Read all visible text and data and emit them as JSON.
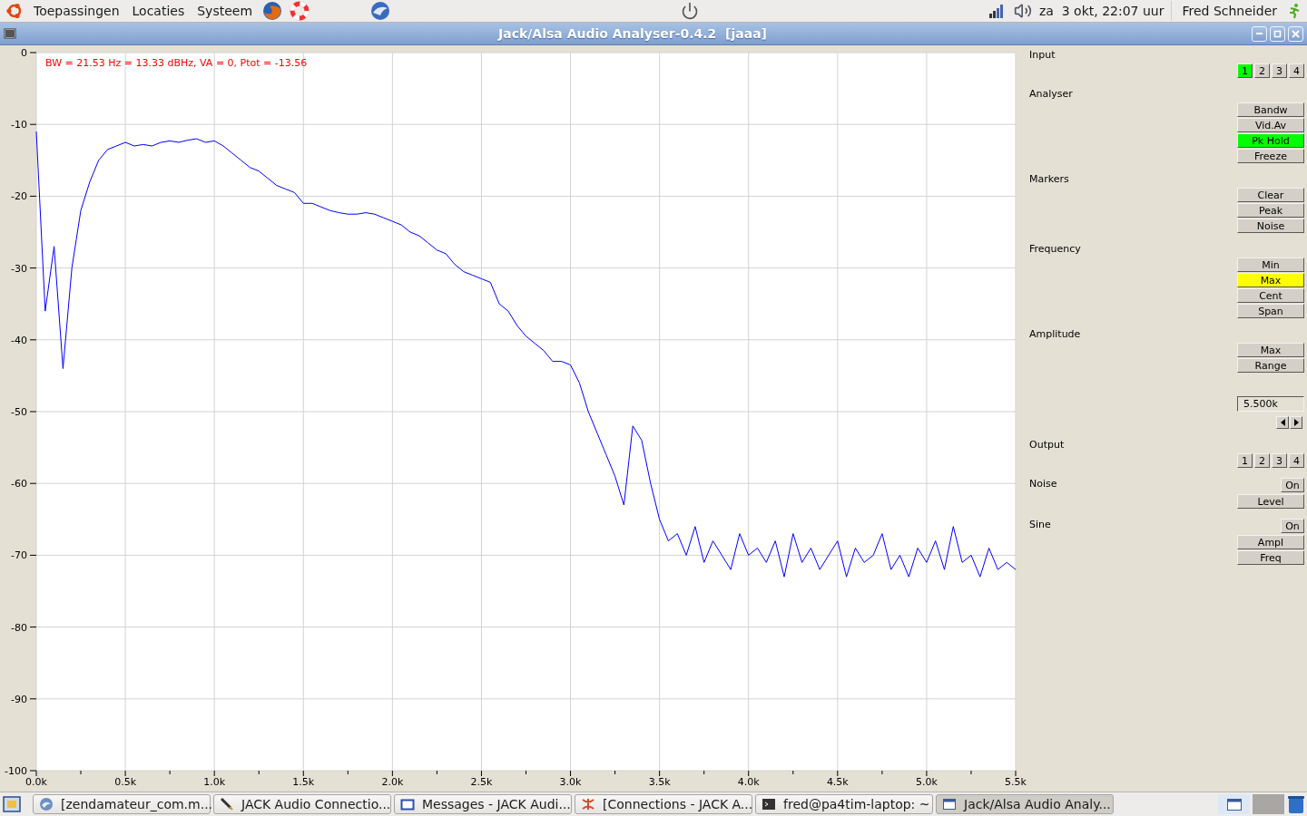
{
  "top_panel": {
    "menus": [
      "Toepassingen",
      "Locaties",
      "Systeem"
    ],
    "clock": "za  3 okt, 22:07 uur",
    "user": "Fred Schneider"
  },
  "window": {
    "title": "Jack/Alsa Audio Analyser-0.4.2  [jaaa]"
  },
  "spectrum": {
    "readout": "BW = 21.53 Hz = 13.33 dBHz, VA = 0, Ptot = -13.56",
    "chart_data": {
      "type": "line",
      "grid": true,
      "xlim": [
        0,
        5.5
      ],
      "ylim": [
        -100,
        0
      ],
      "xticks": [
        {
          "value": 0,
          "label": "0.0k"
        },
        {
          "value": 0.5,
          "label": "0.5k"
        },
        {
          "value": 1,
          "label": "1.0k"
        },
        {
          "value": 1.5,
          "label": "1.5k"
        },
        {
          "value": 2,
          "label": "2.0k"
        },
        {
          "value": 2.5,
          "label": "2.5k"
        },
        {
          "value": 3,
          "label": "3.0k"
        },
        {
          "value": 3.5,
          "label": "3.5k"
        },
        {
          "value": 4,
          "label": "4.0k"
        },
        {
          "value": 4.5,
          "label": "4.5k"
        },
        {
          "value": 5,
          "label": "5.0k"
        },
        {
          "value": 5.5,
          "label": "5.5k"
        }
      ],
      "yticks": [
        0,
        -10,
        -20,
        -30,
        -40,
        -50,
        -60,
        -70,
        -80,
        -90,
        -100
      ],
      "x": [
        0,
        0.05,
        0.1,
        0.15,
        0.2,
        0.25,
        0.3,
        0.35,
        0.4,
        0.45,
        0.5,
        0.55,
        0.6,
        0.65,
        0.7,
        0.75,
        0.8,
        0.85,
        0.9,
        0.95,
        1,
        1.05,
        1.1,
        1.15,
        1.2,
        1.25,
        1.3,
        1.35,
        1.4,
        1.45,
        1.5,
        1.55,
        1.6,
        1.65,
        1.7,
        1.75,
        1.8,
        1.85,
        1.9,
        1.95,
        2,
        2.05,
        2.1,
        2.15,
        2.2,
        2.25,
        2.3,
        2.35,
        2.4,
        2.45,
        2.5,
        2.55,
        2.6,
        2.65,
        2.7,
        2.75,
        2.8,
        2.85,
        2.9,
        2.95,
        3,
        3.05,
        3.1,
        3.15,
        3.2,
        3.25,
        3.3,
        3.35,
        3.4,
        3.45,
        3.5,
        3.55,
        3.6,
        3.65,
        3.7,
        3.75,
        3.8,
        3.85,
        3.9,
        3.95,
        4,
        4.05,
        4.1,
        4.15,
        4.2,
        4.25,
        4.3,
        4.35,
        4.4,
        4.45,
        4.5,
        4.55,
        4.6,
        4.65,
        4.7,
        4.75,
        4.8,
        4.85,
        4.9,
        4.95,
        5,
        5.05,
        5.1,
        5.15,
        5.2,
        5.25,
        5.3,
        5.35,
        5.4,
        5.45,
        5.5
      ],
      "series": [
        {
          "color": "#0000ff",
          "values": [
            -11,
            -36,
            -27,
            -44,
            -30,
            -22,
            -18,
            -15,
            -13.5,
            -13,
            -12.5,
            -13,
            -12.8,
            -13,
            -12.5,
            -12.3,
            -12.5,
            -12.2,
            -12,
            -12.5,
            -12.3,
            -13,
            -14,
            -15,
            -16,
            -16.5,
            -17.5,
            -18.5,
            -19,
            -19.5,
            -21,
            -21,
            -21.5,
            -22,
            -22.3,
            -22.5,
            -22.5,
            -22.3,
            -22.5,
            -23,
            -23.5,
            -24,
            -25,
            -25.5,
            -26.5,
            -27.5,
            -28,
            -29.5,
            -30.5,
            -31,
            -31.5,
            -32,
            -35,
            -36,
            -38,
            -39.5,
            -40.5,
            -41.5,
            -43,
            -43,
            -43.5,
            -46,
            -50,
            -53,
            -56,
            -59,
            -63,
            -52,
            -54,
            -60,
            -65,
            -68,
            -67,
            -70,
            -66,
            -71,
            -68,
            -70,
            -72,
            -67,
            -70,
            -69,
            -71,
            -68,
            -73,
            -67,
            -71,
            -69,
            -72,
            -70,
            -68,
            -73,
            -69,
            -71,
            -70,
            -67,
            -72,
            -70,
            -73,
            -69,
            -71,
            -68,
            -72,
            -66,
            -71,
            -70,
            -73,
            -69,
            -72,
            -71,
            -72
          ]
        }
      ]
    }
  },
  "controls": [
    {
      "label": "Input",
      "rows": [
        {
          "kind": "numbers",
          "buttons": [
            {
              "label": "1",
              "selected": true,
              "color": "#00ff00"
            },
            {
              "label": "2",
              "selected": false
            },
            {
              "label": "3",
              "selected": false
            },
            {
              "label": "4",
              "selected": false
            }
          ]
        }
      ]
    },
    {
      "label": "Analyser",
      "rows": [
        {
          "kind": "stack",
          "buttons": [
            {
              "label": "Bandw",
              "selected": false
            },
            {
              "label": "Vid.Av",
              "selected": false
            },
            {
              "label": "Pk Hold",
              "selected": true,
              "color": "#00ff00"
            },
            {
              "label": "Freeze",
              "selected": false
            }
          ]
        }
      ]
    },
    {
      "label": "Markers",
      "rows": [
        {
          "kind": "stack",
          "buttons": [
            {
              "label": "Clear",
              "selected": false
            },
            {
              "label": "Peak",
              "selected": false
            },
            {
              "label": "Noise",
              "selected": false
            }
          ]
        }
      ]
    },
    {
      "label": "Frequency",
      "rows": [
        {
          "kind": "stack",
          "buttons": [
            {
              "label": "Min",
              "selected": false
            },
            {
              "label": "Max",
              "selected": true,
              "color": "#ffff00"
            },
            {
              "label": "Cent",
              "selected": false
            },
            {
              "label": "Span",
              "selected": false
            }
          ]
        }
      ]
    },
    {
      "label": "Amplitude",
      "rows": [
        {
          "kind": "stack",
          "buttons": [
            {
              "label": "Max",
              "selected": false
            },
            {
              "label": "Range",
              "selected": false
            }
          ]
        },
        {
          "kind": "field",
          "value": "5.500k"
        }
      ]
    },
    {
      "label": "Output",
      "rows": [
        {
          "kind": "numbers",
          "buttons": [
            {
              "label": "1",
              "selected": false
            },
            {
              "label": "2",
              "selected": false
            },
            {
              "label": "3",
              "selected": false
            },
            {
              "label": "4",
              "selected": false
            }
          ]
        }
      ]
    },
    {
      "label": "Noise",
      "toggle": {
        "label": "On",
        "selected": false
      },
      "rows": [
        {
          "kind": "stack",
          "buttons": [
            {
              "label": "Level",
              "selected": false
            }
          ]
        }
      ]
    },
    {
      "label": "Sine",
      "toggle": {
        "label": "On",
        "selected": false
      },
      "rows": [
        {
          "kind": "stack",
          "buttons": [
            {
              "label": "Ampl",
              "selected": false
            },
            {
              "label": "Freq",
              "selected": false
            }
          ]
        }
      ]
    }
  ],
  "taskbar": {
    "tasks": [
      {
        "label": "[zendamateur_com.m...",
        "selected": false
      },
      {
        "label": "JACK Audio Connectio...",
        "selected": false
      },
      {
        "label": "Messages - JACK Audi...",
        "selected": false
      },
      {
        "label": "[Connections - JACK A...",
        "selected": false
      },
      {
        "label": "fred@pa4tim-laptop: ~",
        "selected": false
      },
      {
        "label": "Jack/Alsa Audio Analy...",
        "selected": true
      }
    ],
    "workspaces": [
      {
        "selected": true
      },
      {
        "selected": false
      }
    ]
  }
}
